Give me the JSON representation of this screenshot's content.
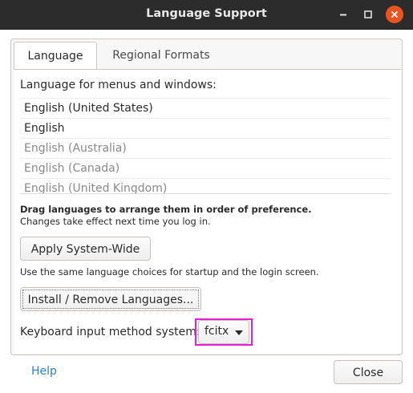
{
  "window": {
    "title": "Language Support"
  },
  "tabs": [
    {
      "label": "Language",
      "active": true
    },
    {
      "label": "Regional Formats",
      "active": false
    }
  ],
  "language_section": {
    "label": "Language for menus and windows:",
    "items": [
      {
        "label": "English (United States)",
        "enabled": true
      },
      {
        "label": "English",
        "enabled": true
      },
      {
        "label": "English (Australia)",
        "enabled": false
      },
      {
        "label": "English (Canada)",
        "enabled": false
      },
      {
        "label": "English (United Kingdom)",
        "enabled": false
      }
    ],
    "drag_hint": "Drag languages to arrange them in order of preference.",
    "drag_subhint": "Changes take effect next time you log in."
  },
  "apply": {
    "label": "Apply System-Wide",
    "description": "Use the same language choices for startup and the login screen."
  },
  "install": {
    "label": "Install / Remove Languages..."
  },
  "keyboard": {
    "label": "Keyboard input method system:",
    "value": "fcitx"
  },
  "footer": {
    "help_label": "Help",
    "close_label": "Close"
  },
  "colors": {
    "titlebar": "#2c2c2c",
    "close_button": "#e95420",
    "link": "#2a7fd4",
    "highlight_box": "#e61fd7"
  }
}
